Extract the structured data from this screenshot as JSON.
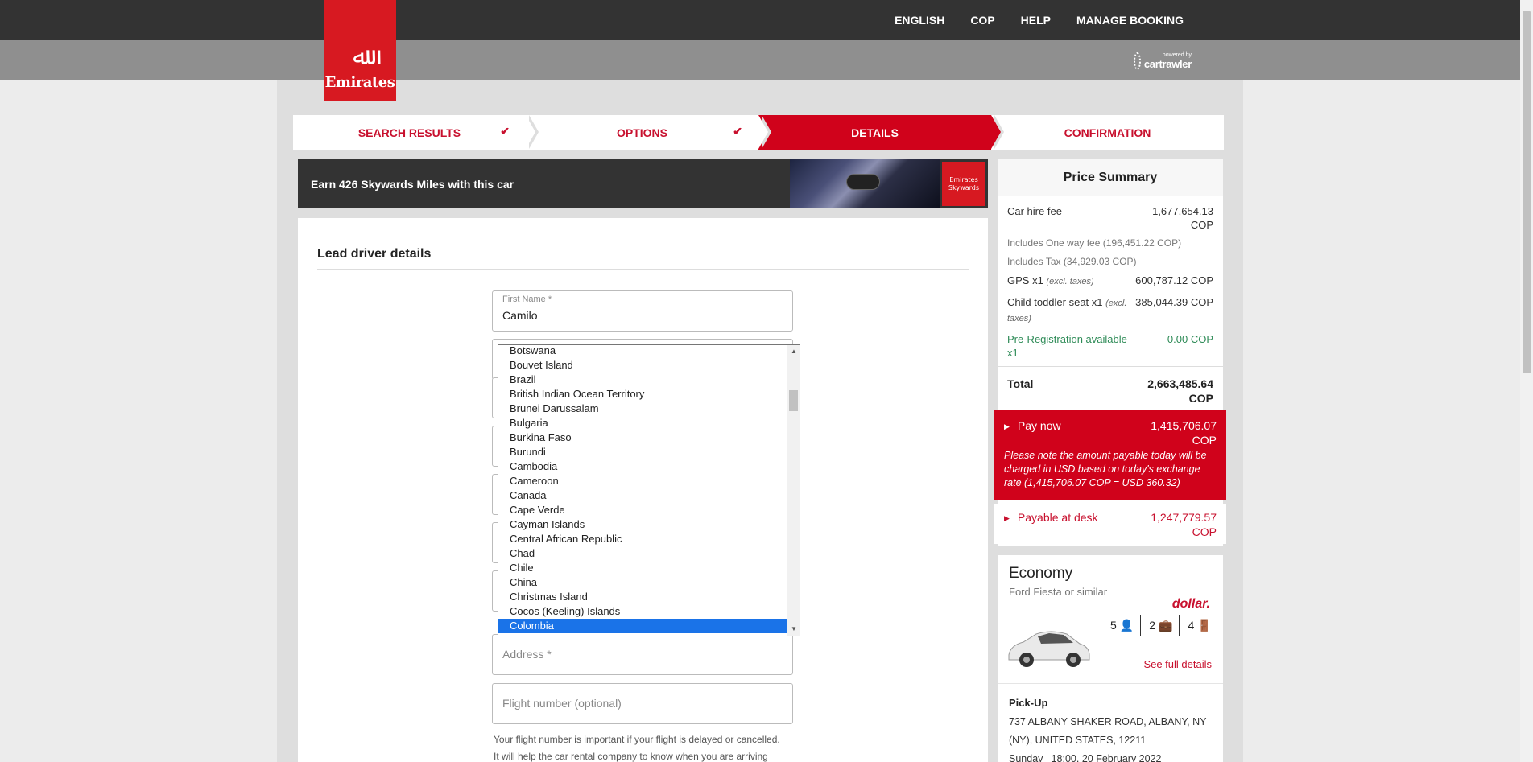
{
  "header": {
    "logo_text": "Emirates",
    "nav": [
      "ENGLISH",
      "COP",
      "HELP",
      "MANAGE BOOKING"
    ],
    "powered_small": "powered by",
    "powered_brand": "cartrawler"
  },
  "steps": [
    {
      "label": "SEARCH RESULTS",
      "done": true
    },
    {
      "label": "OPTIONS",
      "done": true
    },
    {
      "label": "DETAILS",
      "done": false
    },
    {
      "label": "CONFIRMATION",
      "done": false
    }
  ],
  "earn_banner": {
    "text": "Earn 426 Skywards Miles with this car",
    "badge_line1": "Emirates",
    "badge_line2": "Skywards"
  },
  "form": {
    "title": "Lead driver details",
    "first_name_label": "First Name *",
    "first_name_value": "Camilo",
    "address_placeholder": "Address *",
    "flight_placeholder": "Flight number (optional)",
    "flight_hint_line1": "Your flight number is important if your flight is delayed or cancelled.",
    "flight_hint_line2": "It will help the car rental company to know when you are arriving"
  },
  "country_dropdown": {
    "options": [
      "Botswana",
      "Bouvet Island",
      "Brazil",
      "British Indian Ocean Territory",
      "Brunei Darussalam",
      "Bulgaria",
      "Burkina Faso",
      "Burundi",
      "Cambodia",
      "Cameroon",
      "Canada",
      "Cape Verde",
      "Cayman Islands",
      "Central African Republic",
      "Chad",
      "Chile",
      "China",
      "Christmas Island",
      "Cocos (Keeling) Islands",
      "Colombia"
    ],
    "selected": "Colombia"
  },
  "price_summary": {
    "title": "Price Summary",
    "car_hire_label": "Car hire fee",
    "car_hire_value": "1,677,654.13 COP",
    "one_way_note": "Includes One way fee (196,451.22 COP)",
    "tax_note": "Includes Tax (34,929.03 COP)",
    "gps_label": "GPS x1",
    "gps_excl": "(excl. taxes)",
    "gps_value": "600,787.12 COP",
    "seat_label": "Child toddler seat x1",
    "seat_excl": "(excl. taxes)",
    "seat_value": "385,044.39 COP",
    "prereg_label": "Pre-Registration available x1",
    "prereg_value": "0.00 COP",
    "total_label": "Total",
    "total_value": "2,663,485.64 COP",
    "pay_now_label": "Pay now",
    "pay_now_value": "1,415,706.07 COP",
    "pay_now_note": "Please note the amount payable today will be charged in USD based on today's exchange rate (1,415,706.07 COP = USD 360.32)",
    "desk_label": "Payable at desk",
    "desk_value": "1,247,779.57 COP"
  },
  "car": {
    "class": "Economy",
    "model": "Ford Fiesta or similar",
    "vendor": "dollar.",
    "seats": "5",
    "bags": "2",
    "doors": "4",
    "details_link": "See full details",
    "pickup_title": "Pick-Up",
    "pickup_address": "737 ALBANY SHAKER ROAD, ALBANY, NY (NY), UNITED STATES, 12211",
    "pickup_time": "Sunday | 18:00, 20 February 2022"
  },
  "colors": {
    "brand_red": "#d0021b",
    "dark_bar": "#333333",
    "selected_blue": "#1a73e8"
  }
}
